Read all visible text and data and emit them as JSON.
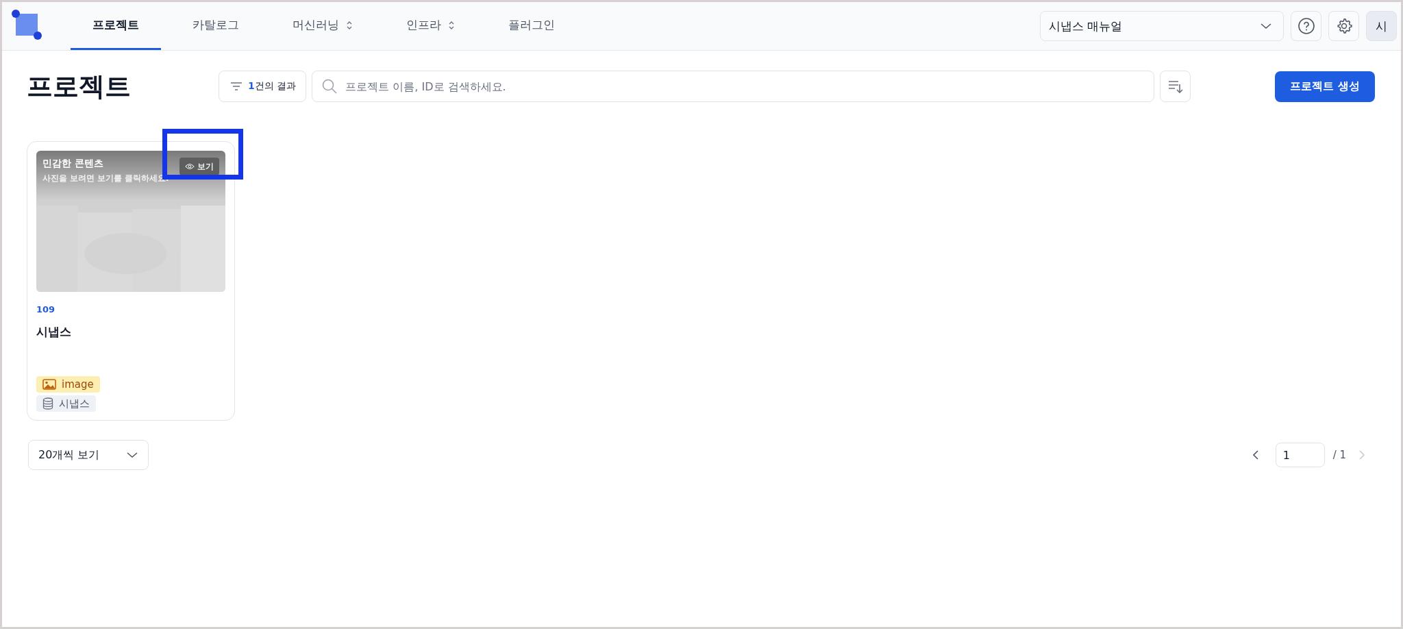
{
  "nav": {
    "tabs": [
      {
        "label": "프로젝트",
        "selected": true,
        "dropdown": false
      },
      {
        "label": "카탈로그",
        "selected": false,
        "dropdown": false
      },
      {
        "label": "머신러닝",
        "selected": false,
        "dropdown": true
      },
      {
        "label": "인프라",
        "selected": false,
        "dropdown": true
      },
      {
        "label": "플러그인",
        "selected": false,
        "dropdown": false
      }
    ],
    "workspace": {
      "value": "시냅스 매뉴얼"
    },
    "avatar": "시"
  },
  "header": {
    "title": "프로젝트",
    "result": {
      "count": "1",
      "text": "건의 결과"
    },
    "search": {
      "placeholder": "프로젝트 이름, ID로 검색하세요."
    },
    "create_button": "프로젝트 생성"
  },
  "projects": [
    {
      "id": "109",
      "name": "시냅스",
      "sensitive": {
        "title": "민감한 콘텐츠",
        "message": "사진을 보려면 보기를 클릭하세요.",
        "button": "보기",
        "highlighted": true
      },
      "tags": [
        {
          "kind": "data-type",
          "label": "image"
        },
        {
          "kind": "dataset",
          "label": "시냅스"
        }
      ]
    }
  ],
  "footer": {
    "page_size": "20개씩 보기",
    "page": "1",
    "total": "/ 1",
    "prev_disabled": false,
    "next_disabled": true
  }
}
